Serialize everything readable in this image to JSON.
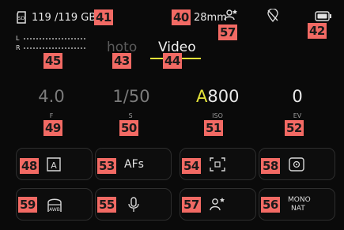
{
  "status_bar": {
    "storage": "119 /119 GB",
    "focal_length": "28mm",
    "icons": [
      "sd-card-icon",
      "face-detect-icon",
      "gps-off-icon",
      "battery-icon"
    ]
  },
  "audio_meter": {
    "left_label": "L",
    "right_label": "R"
  },
  "mode_tabs": [
    {
      "label": "Photo",
      "visible_text": "hoto",
      "active": false
    },
    {
      "label": "Video",
      "visible_text": "Video",
      "active": true
    }
  ],
  "exposure": {
    "aperture": {
      "value": "4.0",
      "label": "F"
    },
    "shutter": {
      "value": "1/50",
      "label": "S"
    },
    "iso": {
      "prefix": "A",
      "value": "800",
      "label": "ISO"
    },
    "ev": {
      "value": "0",
      "label": "EV"
    }
  },
  "tiles_row1": [
    {
      "name": "exposure-mode",
      "icon": "auto-exposure-icon",
      "text": ""
    },
    {
      "name": "focus-mode",
      "icon": "",
      "text": "AFs"
    },
    {
      "name": "af-field",
      "icon": "af-field-icon",
      "text": ""
    },
    {
      "name": "metering",
      "icon": "metering-icon",
      "text": ""
    }
  ],
  "tiles_row2": [
    {
      "name": "white-balance",
      "icon": "white-balance-icon",
      "text": ""
    },
    {
      "name": "microphone",
      "icon": "microphone-icon",
      "text": ""
    },
    {
      "name": "face-detect",
      "icon": "face-detect-icon",
      "text": ""
    },
    {
      "name": "film-style",
      "icon": "",
      "text": "MONO NAT",
      "line1": "MONO",
      "line2": "NAT"
    }
  ],
  "callouts": {
    "c40": "40",
    "c41": "41",
    "c42": "42",
    "c43": "43",
    "c44": "44",
    "c45": "45",
    "c48": "48",
    "c49": "49",
    "c50": "50",
    "c51": "51",
    "c52": "52",
    "c53": "53",
    "c54": "54",
    "c55": "55",
    "c56": "56",
    "c57a": "57",
    "c57b": "57",
    "c58": "58",
    "c59": "59"
  },
  "colors": {
    "accent_yellow": "#e4e33a",
    "callout_red": "#f26a64"
  }
}
